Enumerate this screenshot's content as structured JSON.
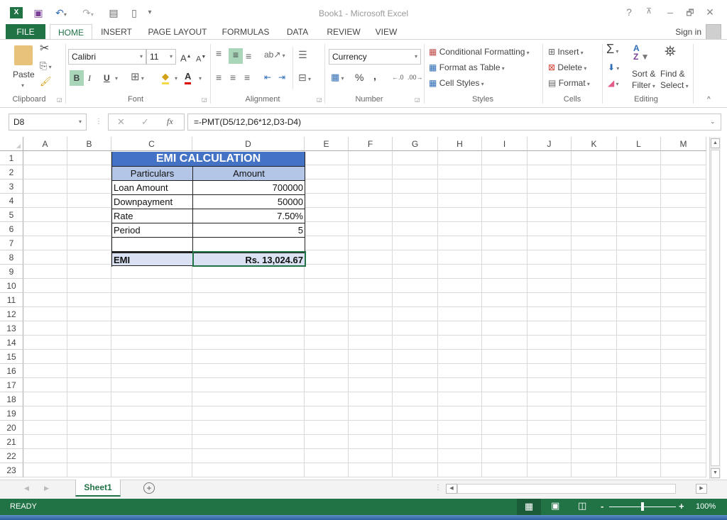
{
  "titlebar": {
    "title": "Book1 - Microsoft Excel",
    "qat": [
      "excel-logo-icon",
      "save-icon",
      "undo-icon",
      "redo-icon",
      "form-icon",
      "new-document-icon",
      "customize-qat-icon"
    ],
    "help": "?",
    "restore_ribbon": "⊼",
    "minimize": "–",
    "restore": "🗗",
    "close": "✕"
  },
  "tabs": [
    {
      "label": "FILE"
    },
    {
      "label": "HOME"
    },
    {
      "label": "INSERT"
    },
    {
      "label": "PAGE LAYOUT"
    },
    {
      "label": "FORMULAS"
    },
    {
      "label": "DATA"
    },
    {
      "label": "REVIEW"
    },
    {
      "label": "VIEW"
    }
  ],
  "sign_in": "Sign in",
  "ribbon": {
    "clipboard": {
      "label": "Clipboard",
      "paste": "Paste"
    },
    "font": {
      "label": "Font",
      "name": "Calibri",
      "size": "11",
      "bold": "B",
      "italic": "I",
      "underline": "U",
      "grow": "A",
      "shrink": "A"
    },
    "alignment": {
      "label": "Alignment"
    },
    "number": {
      "label": "Number",
      "format": "Currency",
      "percent": "%",
      "comma": ",",
      "inc_decimal": "←.0 .00",
      "dec_decimal": ".00 →.0"
    },
    "styles": {
      "label": "Styles",
      "conditional": "Conditional Formatting",
      "format_table": "Format as Table",
      "cell_styles": "Cell Styles"
    },
    "cells": {
      "label": "Cells",
      "insert": "Insert",
      "delete": "Delete",
      "format": "Format"
    },
    "editing": {
      "label": "Editing",
      "sort1": "Sort &",
      "sort2": "Filter",
      "find1": "Find &",
      "find2": "Select",
      "sigma": "Σ"
    }
  },
  "formula_bar": {
    "name_box": "D8",
    "cancel": "✕",
    "enter": "✓",
    "fx": "fx",
    "formula": "=-PMT(D5/12,D6*12,D3-D4)"
  },
  "columns": [
    "A",
    "B",
    "C",
    "D",
    "E",
    "F",
    "G",
    "H",
    "I",
    "J",
    "K",
    "L",
    "M"
  ],
  "rows": [
    "1",
    "2",
    "3",
    "4",
    "5",
    "6",
    "7",
    "8",
    "9",
    "10",
    "11",
    "12",
    "13",
    "14",
    "15",
    "16",
    "17",
    "18",
    "19",
    "20",
    "21",
    "22",
    "23"
  ],
  "table": {
    "title": "EMI CALCULATION",
    "headers": [
      "Particulars",
      "Amount"
    ],
    "rows": [
      {
        "label": "Loan Amount",
        "value": "700000"
      },
      {
        "label": "Downpayment",
        "value": "50000"
      },
      {
        "label": "Rate",
        "value": "7.50%"
      },
      {
        "label": "Period",
        "value": "5"
      },
      {
        "label": "",
        "value": ""
      }
    ],
    "result": {
      "label": "EMI",
      "value": "Rs. 13,024.67"
    },
    "colors": {
      "title_bg": "#4472c4",
      "header_bg": "#b4c6e7",
      "result_bg": "#d9e1f2"
    }
  },
  "sheet_tabs": [
    {
      "label": "Sheet1"
    }
  ],
  "add_sheet": "+",
  "status": {
    "mode": "READY",
    "zoom": "100%",
    "zoom_minus": "-",
    "zoom_plus": "+",
    "zoom_level_percent": 100
  },
  "colors": {
    "accent": "#217346"
  }
}
